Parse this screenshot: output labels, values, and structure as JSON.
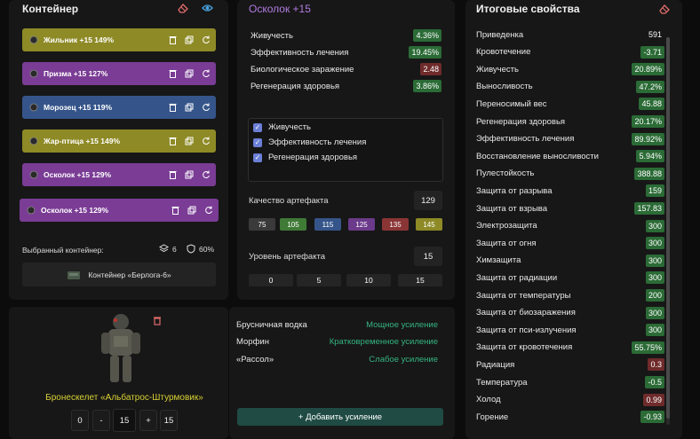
{
  "container": {
    "title": "Контейнер",
    "items": [
      {
        "label": "Жильник +15 149%",
        "color": "#8e8a26",
        "icon": "artifact-dark-icon"
      },
      {
        "label": "Призма +15 127%",
        "color": "#7a3c95",
        "icon": "artifact-prism-icon"
      },
      {
        "label": "Морозец +15 119%",
        "color": "#35558a",
        "icon": "artifact-frost-icon"
      },
      {
        "label": "Жар-птица +15 149%",
        "color": "#8e8a26",
        "icon": "artifact-firebird-icon"
      },
      {
        "label": "Осколок +15 129%",
        "color": "#7a3c95",
        "icon": "artifact-shard-icon"
      },
      {
        "label": "Осколок +15 129%",
        "color": "#7a3c95",
        "icon": "artifact-shard-icon"
      }
    ],
    "selected_label": "Выбранный контейнер:",
    "slots": "6",
    "protection": "60%",
    "selected_name": "Контейнер «Берлога-6»"
  },
  "artifact": {
    "title": "Осколок +15",
    "stats": [
      {
        "name": "Живучесть",
        "value": "4.36%",
        "kind": "green"
      },
      {
        "name": "Эффективность лечения",
        "value": "19.45%",
        "kind": "green"
      },
      {
        "name": "Биологическое заражение",
        "value": "2.48",
        "kind": "red"
      },
      {
        "name": "Регенерация здоровья",
        "value": "3.86%",
        "kind": "green"
      }
    ],
    "checks": [
      "Живучесть",
      "Эффективность лечения",
      "Регенерация здоровья"
    ],
    "quality_label": "Качество артефакта",
    "quality_value": "129",
    "quality_options": [
      {
        "label": "75",
        "color": "#3a3a3a"
      },
      {
        "label": "105",
        "color": "#3f7a36"
      },
      {
        "label": "115",
        "color": "#35558a"
      },
      {
        "label": "125",
        "color": "#6b3a8a"
      },
      {
        "label": "135",
        "color": "#8a3535"
      },
      {
        "label": "145",
        "color": "#8e8a26"
      }
    ],
    "level_label": "Уровень артефакта",
    "level_value": "15",
    "level_options": [
      "0",
      "5",
      "10",
      "15"
    ]
  },
  "suit": {
    "name": "Бронескелет «Альбатрос-Штурмовик»",
    "ctrl_min": "0",
    "ctrl_minus": "-",
    "ctrl_value": "15",
    "ctrl_plus": "+",
    "ctrl_max": "15"
  },
  "boosts": {
    "items": [
      {
        "name": "Брусничная водка",
        "value": "Мощное усиление"
      },
      {
        "name": "Морфин",
        "value": "Кратковременное усиление"
      },
      {
        "name": "«Рассол»",
        "value": "Слабое усиление"
      }
    ],
    "add_label": "+ Добавить усиление"
  },
  "totals": {
    "title": "Итоговые свойства",
    "items": [
      {
        "name": "Приведенка",
        "value": "591",
        "kind": "plain"
      },
      {
        "name": "Кровотечение",
        "value": "-3.71",
        "kind": "green"
      },
      {
        "name": "Живучесть",
        "value": "20.89%",
        "kind": "green"
      },
      {
        "name": "Выносливость",
        "value": "47.2%",
        "kind": "green"
      },
      {
        "name": "Переносимый вес",
        "value": "45.88",
        "kind": "green"
      },
      {
        "name": "Регенерация здоровья",
        "value": "20.17%",
        "kind": "green"
      },
      {
        "name": "Эффективность лечения",
        "value": "89.92%",
        "kind": "green"
      },
      {
        "name": "Восстановление выносливости",
        "value": "5.94%",
        "kind": "green"
      },
      {
        "name": "Пулестойкость",
        "value": "388.88",
        "kind": "green"
      },
      {
        "name": "Защита от разрыва",
        "value": "159",
        "kind": "green"
      },
      {
        "name": "Защита от взрыва",
        "value": "157.83",
        "kind": "green"
      },
      {
        "name": "Электрозащита",
        "value": "300",
        "kind": "green"
      },
      {
        "name": "Защита от огня",
        "value": "300",
        "kind": "green"
      },
      {
        "name": "Химзащита",
        "value": "300",
        "kind": "green"
      },
      {
        "name": "Защита от радиации",
        "value": "300",
        "kind": "green"
      },
      {
        "name": "Защита от температуры",
        "value": "200",
        "kind": "green"
      },
      {
        "name": "Защита от биозаражения",
        "value": "300",
        "kind": "green"
      },
      {
        "name": "Защита от пси-излучения",
        "value": "300",
        "kind": "green"
      },
      {
        "name": "Защита от кровотечения",
        "value": "55.75%",
        "kind": "green"
      },
      {
        "name": "Радиация",
        "value": "0.3",
        "kind": "red"
      },
      {
        "name": "Температура",
        "value": "-0.5",
        "kind": "green"
      },
      {
        "name": "Холод",
        "value": "0.99",
        "kind": "red"
      },
      {
        "name": "Горение",
        "value": "-0.93",
        "kind": "green"
      }
    ]
  }
}
